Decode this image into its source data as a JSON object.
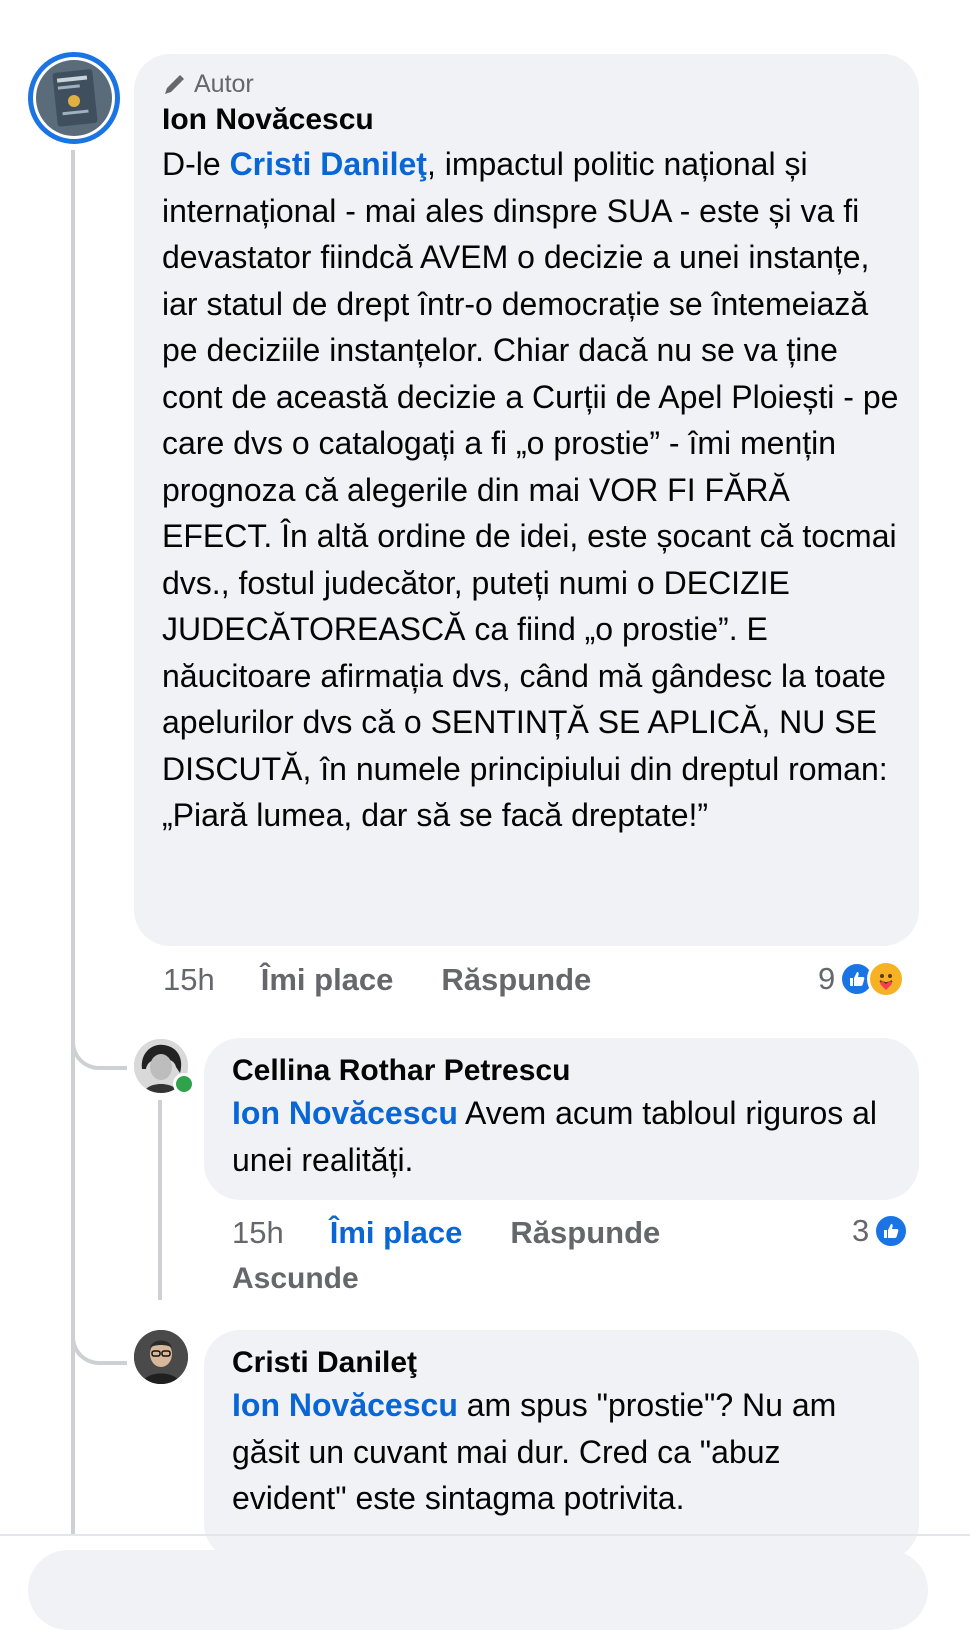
{
  "comment": {
    "badge": "Autor",
    "author": "Ion Novăcescu",
    "mention": "Cristi Danileţ",
    "text_before": "D-le ",
    "text_after": ", impactul politic național și internațional - mai ales dinspre SUA - este și va fi devastator fiindcă AVEM o decizie a unei instanțe, iar statul de drept într-o democrație se întemeiază pe deciziile instanțelor. Chiar dacă nu se va ține cont de această decizie a Curții de Apel Ploiești - pe care dvs o catalogați a fi „o prostie” - îmi mențin prognoza că alegerile din mai VOR FI FĂRĂ EFECT. În altă ordine de idei, este șocant că tocmai dvs., fostul judecător, puteți numi o DECIZIE JUDECĂTOREASCĂ ca fiind „o prostie”. E năucitoare afirmația dvs, când mă gândesc la toate apelurilor dvs că o SENTINȚĂ SE APLICĂ, NU SE DISCUTĂ, în numele principiului din dreptul roman: „Piară lumea, dar să se facă dreptate!”",
    "time": "15h",
    "like_label": "Îmi place",
    "reply_label": "Răspunde",
    "reaction_count": "9"
  },
  "reply1": {
    "author": "Cellina Rothar Petrescu",
    "mention": "Ion Novăcescu",
    "text": " Avem acum tabloul riguros al unei realități.",
    "time": "15h",
    "like_label": "Îmi place",
    "reply_label": "Răspunde",
    "reaction_count": "3",
    "hide_label": "Ascunde"
  },
  "reply2": {
    "author": "Cristi Danileţ",
    "mention": "Ion Novăcescu",
    "text": " am spus \"prostie\"? Nu am găsit un cuvant mai dur. Cred ca \"abuz evident\" este sintagma potrivita."
  },
  "colors": {
    "accent": "#0866d6",
    "bubble": "#f0f2f5",
    "meta": "#65676b",
    "online": "#31a24c"
  }
}
